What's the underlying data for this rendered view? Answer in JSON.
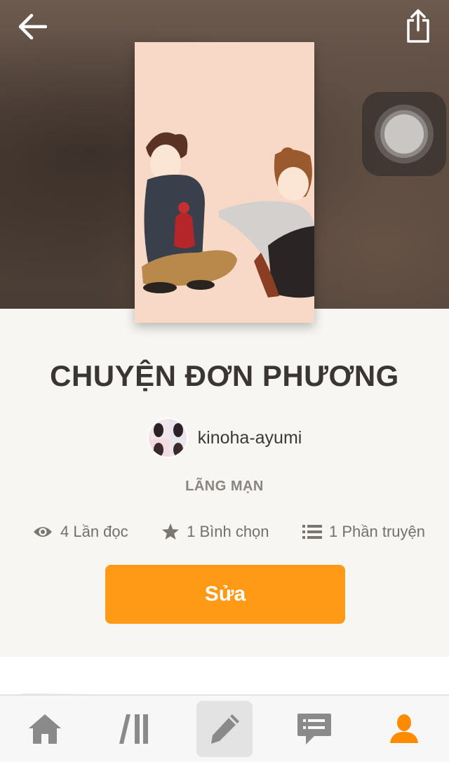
{
  "header": {
    "back_icon": "arrow-left-icon",
    "share_icon": "share-icon"
  },
  "story": {
    "title": "CHUYỆN ĐƠN PHƯƠNG",
    "author": "kinoha-ayumi",
    "genre": "LÃNG MẠN",
    "stats": {
      "reads": "4 Lần đọc",
      "votes": "1 Bình chọn",
      "parts": "1 Phần truyện"
    },
    "edit_label": "Sửa"
  },
  "tabs": [
    {
      "name": "home",
      "icon": "home-icon"
    },
    {
      "name": "library",
      "icon": "library-icon"
    },
    {
      "name": "write",
      "icon": "pencil-icon"
    },
    {
      "name": "messages",
      "icon": "chat-icon"
    },
    {
      "name": "profile",
      "icon": "user-icon"
    }
  ],
  "colors": {
    "accent": "#ff9a16",
    "profile_active": "#ff8c00",
    "tab_inactive": "#8a8a8a"
  }
}
